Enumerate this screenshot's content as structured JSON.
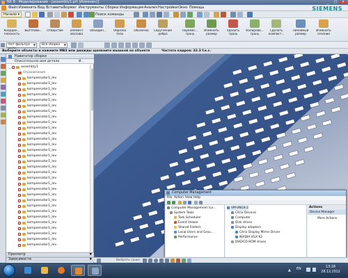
{
  "window": {
    "title": "NX 8 - Моделирование - [assembly1.prt (Изменен)]",
    "brand": "SIEMENS",
    "minimize": "_",
    "maximize": "□",
    "close": "✕"
  },
  "menubar": [
    "Файл",
    "Изменить",
    "Вид",
    "Вставить",
    "Формат",
    "Инструменты",
    "Сборки",
    "Информация",
    "Анализ",
    "Настройки",
    "Окно",
    "Помощь"
  ],
  "toolbar1": {
    "start_label": "Начало ▾",
    "command_search": "Поиск команды"
  },
  "toolbar2": [
    "Координ... плоскость",
    "Вытягива...",
    "Отверстие",
    "Элемент массива",
    "Объедин...",
    "Обрезка тела",
    "Оболочка",
    "Скругление ребра",
    "Перемес... грань",
    "Изменить размер",
    "Удалить грань",
    "Копирова... грань",
    "Сделать компакт...",
    "Линейный размер",
    "Изменить сечение"
  ],
  "filterbar": {
    "filter": "Нет фильтра выбо",
    "scope": "Вся сборка"
  },
  "status": {
    "prompt": "Выберите объекты и нажмите MB3 или дважды щелкните мышкой на объекте",
    "fps": "Частота кадров: 32.3 f.к.с."
  },
  "navigator": {
    "title": "Навигатор сборки",
    "col_name": "Описательное имя детали",
    "col_info": "И...",
    "root": "assembly1",
    "constraints": "Ограничения",
    "items": [
      "kompensator1_lev",
      "kompensator1_lev",
      "kompensator1_lev",
      "kompensator1_lev",
      "kompensator1_lev",
      "kompensator1_lev",
      "kompensator1_lev",
      "kompensator1_lev",
      "kompensator1_lev",
      "kompensator1_lev",
      "kompensator1_lev",
      "kompensator1_lev",
      "kompensator1_lev",
      "kompensator1_lev",
      "kompensator1_lev",
      "kompensator1_lev",
      "kompensator1_lev",
      "kompensator1_lev",
      "kompensator1_lev",
      "kompensator1_lev",
      "kompensator1_lev",
      "kompensator1_lev",
      "kompensator1_lev",
      "kompensator1_lev",
      "kompensator1_lev",
      "kompensator1_lev",
      "kompensator1_lev",
      "kompensator1_lev",
      "kompensator1_lev",
      "kompensator1_lev",
      "kompensator1_lev"
    ],
    "preview": "Просмотр",
    "dependencies": "Зависимости"
  },
  "computer_management": {
    "title": "Computer Management",
    "menu": [
      "File",
      "Action",
      "View",
      "Help"
    ],
    "tree_left": [
      "Computer Management (Lo...",
      "System Tools",
      "Task Scheduler",
      "Event Viewer",
      "Shared Folders",
      "Local Users and Grou...",
      "Performance"
    ],
    "tree_mid": [
      "VM-VNGX-2",
      "Citrix Devices",
      "Computer",
      "Disk drives",
      "Display adapters",
      "Citrix Display Mirror Driver",
      "NVIDIA VGX K2",
      "DVD/CD-ROM drives"
    ],
    "actions_header": "Actions",
    "actions_selected": "Device Manager",
    "actions_more": "More Actions"
  },
  "selection_toolbar": {
    "hint": "Выбрать сущность..."
  },
  "taskbar": {
    "language": "EN",
    "time": "13:18",
    "date": "28.12.2012"
  }
}
